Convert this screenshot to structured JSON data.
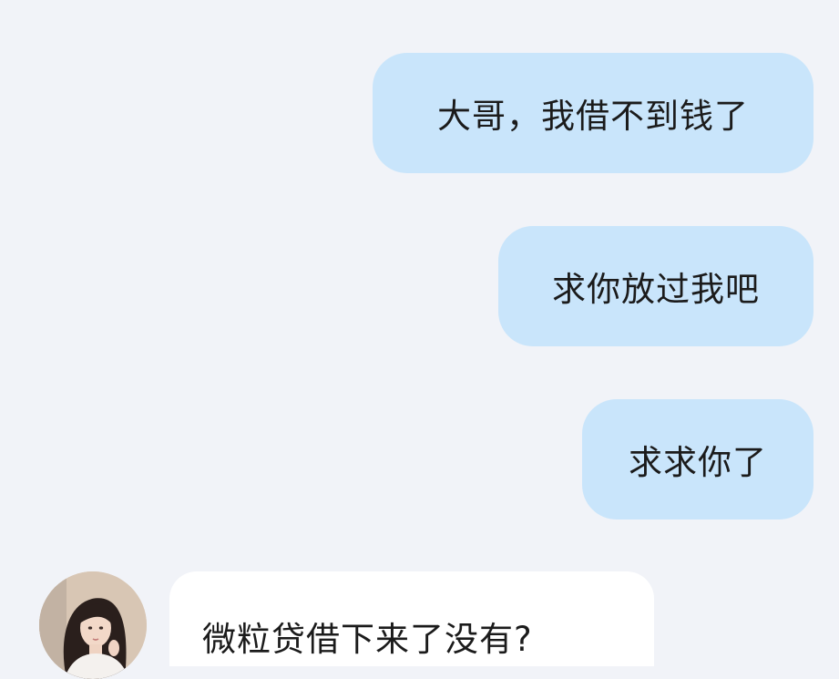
{
  "messages": [
    {
      "direction": "sent",
      "text": "大哥，我借不到钱了"
    },
    {
      "direction": "sent",
      "text": "求你放过我吧"
    },
    {
      "direction": "sent",
      "text": "求求你了"
    },
    {
      "direction": "received",
      "text": "微粒贷借下来了没有?"
    }
  ],
  "contact": {
    "avatar_icon": "avatar-portrait-icon"
  },
  "colors": {
    "background": "#f1f3f8",
    "sent_bubble": "#c9e5fb",
    "received_bubble": "#ffffff",
    "text": "#1b1b1b"
  }
}
